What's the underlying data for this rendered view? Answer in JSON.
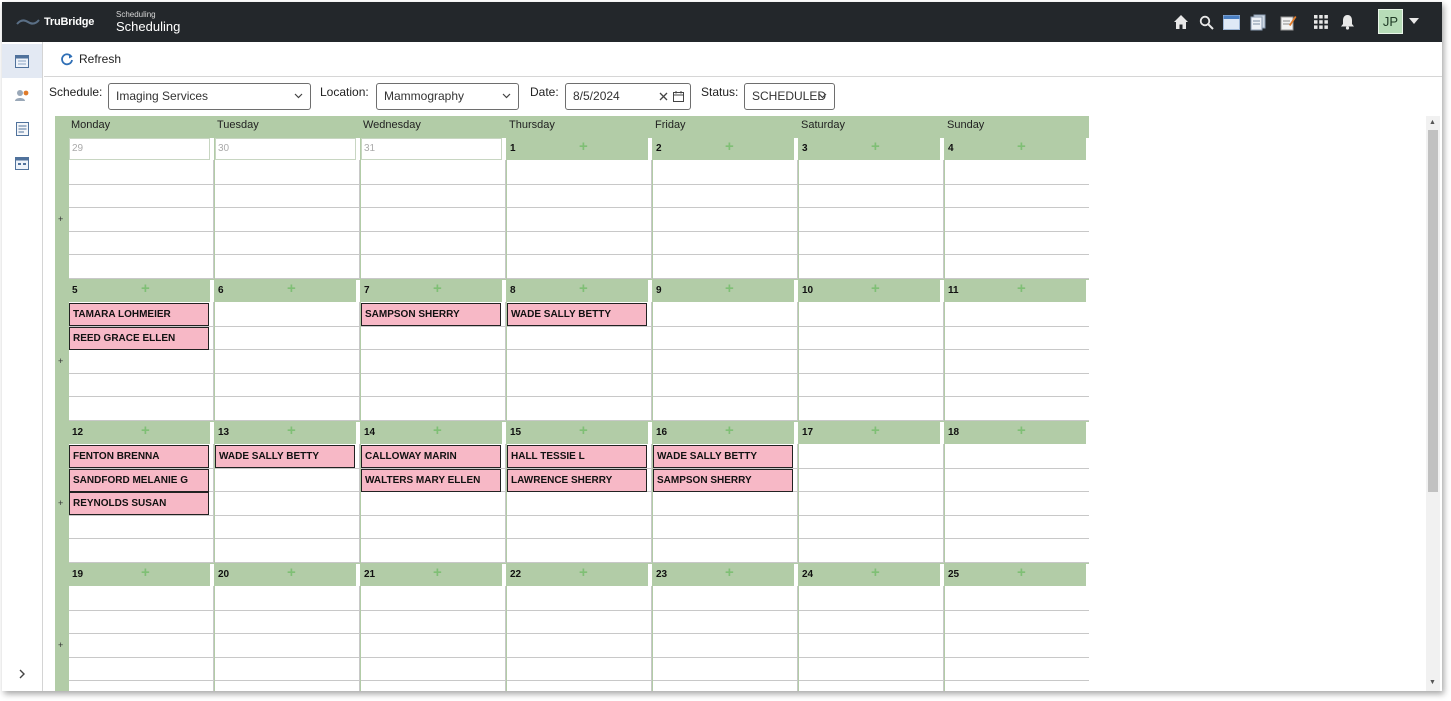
{
  "header": {
    "brand": "TruBridge",
    "module_small": "Scheduling",
    "module_title": "Scheduling",
    "icons": [
      "home-icon",
      "search-icon",
      "window-icon",
      "documents-icon",
      "notes-icon",
      "apps-grid-icon",
      "bell-icon"
    ],
    "user_initials": "JP"
  },
  "sidebar": {
    "items": [
      "calendar-icon",
      "user-location-icon",
      "report-icon",
      "schedule-icon"
    ],
    "expand_icon": "chevron-right-icon"
  },
  "toolbar": {
    "refresh_label": "Refresh"
  },
  "filters": {
    "schedule_label": "Schedule:",
    "schedule_value": "Imaging Services",
    "location_label": "Location:",
    "location_value": "Mammography",
    "date_label": "Date:",
    "date_value": "8/5/2024",
    "status_label": "Status:",
    "status_value": "SCHEDULED"
  },
  "calendar": {
    "weekdays": [
      "Monday",
      "Tuesday",
      "Wednesday",
      "Thursday",
      "Friday",
      "Saturday",
      "Sunday"
    ],
    "week_expand_symbol": "+",
    "add_symbol": "+",
    "weeks": [
      {
        "days": [
          {
            "num": "29",
            "outside": true,
            "appts": []
          },
          {
            "num": "30",
            "outside": true,
            "appts": []
          },
          {
            "num": "31",
            "outside": true,
            "appts": []
          },
          {
            "num": "1",
            "outside": false,
            "appts": []
          },
          {
            "num": "2",
            "outside": false,
            "appts": []
          },
          {
            "num": "3",
            "outside": false,
            "appts": []
          },
          {
            "num": "4",
            "outside": false,
            "appts": []
          }
        ]
      },
      {
        "days": [
          {
            "num": "5",
            "outside": false,
            "appts": [
              "TAMARA LOHMEIER",
              "REED GRACE ELLEN"
            ]
          },
          {
            "num": "6",
            "outside": false,
            "appts": []
          },
          {
            "num": "7",
            "outside": false,
            "appts": [
              "SAMPSON SHERRY"
            ]
          },
          {
            "num": "8",
            "outside": false,
            "appts": [
              "WADE SALLY BETTY"
            ]
          },
          {
            "num": "9",
            "outside": false,
            "appts": []
          },
          {
            "num": "10",
            "outside": false,
            "appts": []
          },
          {
            "num": "11",
            "outside": false,
            "appts": []
          }
        ]
      },
      {
        "days": [
          {
            "num": "12",
            "outside": false,
            "appts": [
              "FENTON BRENNA",
              "SANDFORD MELANIE G",
              "REYNOLDS SUSAN"
            ]
          },
          {
            "num": "13",
            "outside": false,
            "appts": [
              "WADE SALLY BETTY"
            ]
          },
          {
            "num": "14",
            "outside": false,
            "appts": [
              "CALLOWAY MARIN",
              "WALTERS MARY ELLEN"
            ]
          },
          {
            "num": "15",
            "outside": false,
            "appts": [
              "HALL TESSIE L",
              "LAWRENCE SHERRY"
            ]
          },
          {
            "num": "16",
            "outside": false,
            "appts": [
              "WADE SALLY BETTY",
              "SAMPSON SHERRY"
            ]
          },
          {
            "num": "17",
            "outside": false,
            "appts": []
          },
          {
            "num": "18",
            "outside": false,
            "appts": []
          }
        ]
      },
      {
        "days": [
          {
            "num": "19",
            "outside": false,
            "appts": []
          },
          {
            "num": "20",
            "outside": false,
            "appts": []
          },
          {
            "num": "21",
            "outside": false,
            "appts": []
          },
          {
            "num": "22",
            "outside": false,
            "appts": []
          },
          {
            "num": "23",
            "outside": false,
            "appts": []
          },
          {
            "num": "24",
            "outside": false,
            "appts": []
          },
          {
            "num": "25",
            "outside": false,
            "appts": []
          }
        ]
      }
    ]
  },
  "colors": {
    "topbar": "#23272b",
    "calendar_header": "#b2cca7",
    "appointment": "#f7b8c6",
    "avatar": "#b7dcb8"
  }
}
